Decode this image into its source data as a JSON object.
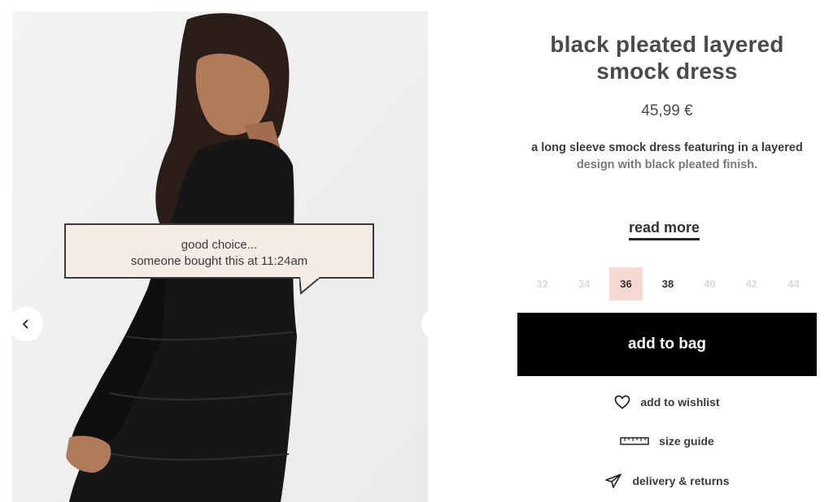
{
  "gallery": {
    "prev_icon": "chevron-left-icon",
    "next_icon": "chevron-right-icon",
    "tooltip": {
      "line1": "good choice...",
      "line2": "someone bought this at 11:24am"
    }
  },
  "product": {
    "title": "black pleated layered smock dress",
    "price": "45,99 €",
    "description_line1": "a long sleeve smock dress featuring in a layered",
    "description_line2": "design with black pleated finish.",
    "read_more": "read more"
  },
  "sizes": [
    {
      "label": "32",
      "state": "unavailable"
    },
    {
      "label": "34",
      "state": "unavailable"
    },
    {
      "label": "36",
      "state": "selected"
    },
    {
      "label": "38",
      "state": "available"
    },
    {
      "label": "40",
      "state": "unavailable"
    },
    {
      "label": "42",
      "state": "unavailable"
    },
    {
      "label": "44",
      "state": "unavailable"
    }
  ],
  "actions": {
    "add_to_bag": "add to bag",
    "wishlist": "add to wishlist",
    "size_guide": "size guide",
    "delivery": "delivery & returns"
  },
  "colors": {
    "selected_size_bg": "#f6d9d3",
    "tooltip_bg": "#f7ebe6",
    "button_bg": "#000000"
  }
}
